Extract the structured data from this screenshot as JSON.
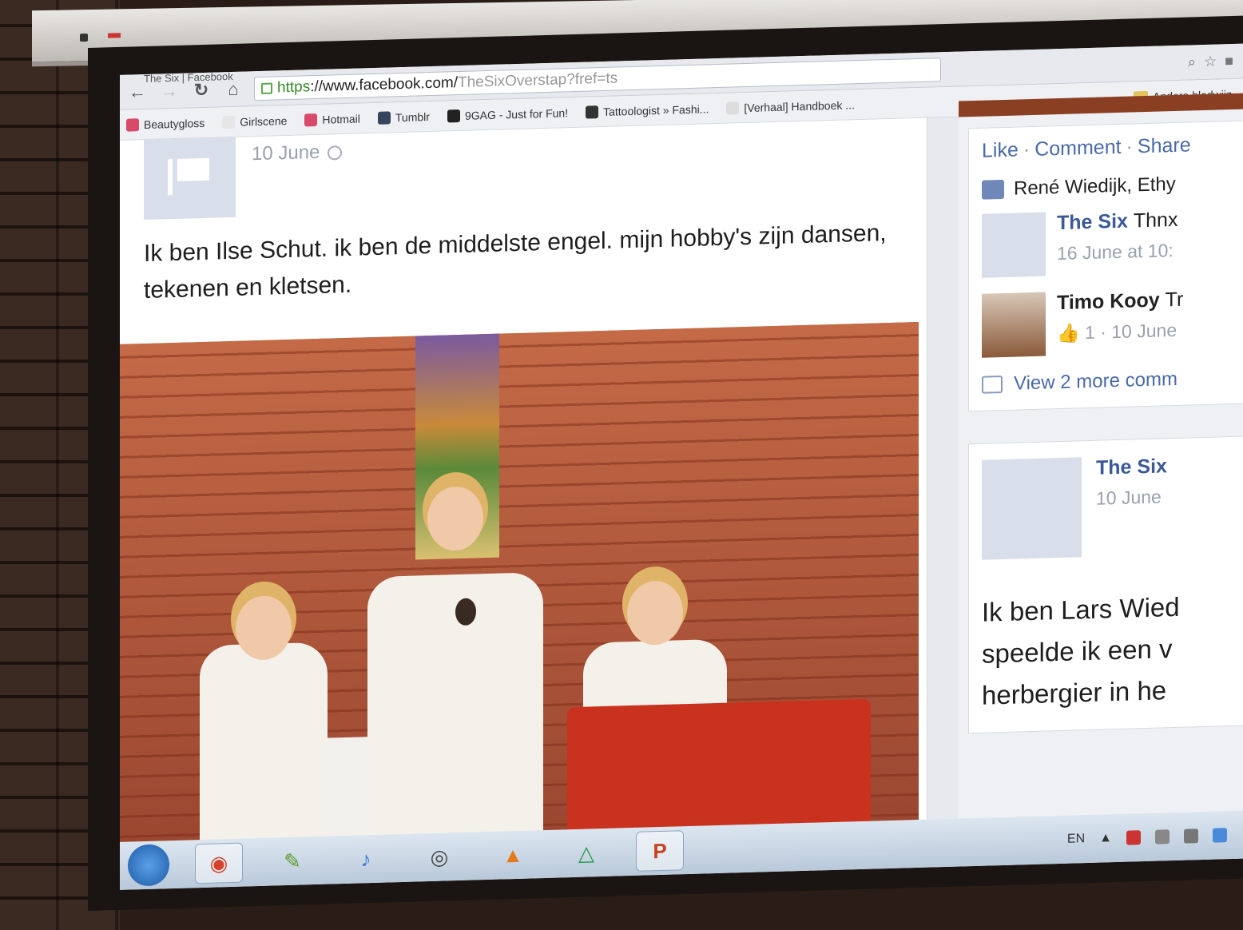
{
  "browser": {
    "tab_title": "The Six | Facebook",
    "url_https": "https",
    "url_host": "://www.facebook.com/",
    "url_path": "TheSixOverstap?fref=ts",
    "bookmarks_top": [
      {
        "label": "Tumblr",
        "color": "#35465c"
      },
      {
        "label": "9GAG - Just for Fun!",
        "color": "#222222"
      },
      {
        "label": "Tattoologist » Fashi...",
        "color": "#333333"
      },
      {
        "label": "[Verhaal] Handboek ...",
        "color": "#dddddd"
      }
    ],
    "bookmarks_left": [
      {
        "label": "Beautygloss",
        "color": "#d94a6a"
      },
      {
        "label": "Girlscene",
        "color": "#e6e6e6"
      },
      {
        "label": "Hotmail",
        "color": "#d94a6a"
      }
    ],
    "other_bookmarks": "Andere bladwijz"
  },
  "post": {
    "date": "10 June",
    "text": "Ik ben Ilse Schut. ik ben de middelste engel. mijn hobby's zijn dansen, tekenen en kletsen."
  },
  "side": {
    "actions": {
      "like": "Like",
      "comment": "Comment",
      "share": "Share"
    },
    "likes_text": "René Wiedijk, Ethy",
    "comments": [
      {
        "name": "The Six",
        "text": "Thnx",
        "meta": "16 June at 10:"
      },
      {
        "name": "Timo Kooy",
        "text": "Tr",
        "meta": "1 · 10 June"
      }
    ],
    "view_more": "View 2 more comm",
    "post2": {
      "name": "The Six",
      "date": "10 June",
      "text_lines": [
        "Ik ben Lars Wied",
        "speelde ik een v",
        "herbergier in he"
      ]
    }
  },
  "taskbar": {
    "apps": [
      {
        "name": "chrome-icon",
        "glyph": "◉",
        "color": "#d9402a"
      },
      {
        "name": "evernote-icon",
        "glyph": "✎",
        "color": "#5a9a2a"
      },
      {
        "name": "itunes-icon",
        "glyph": "♪",
        "color": "#3a7ad9"
      },
      {
        "name": "webcam-icon",
        "glyph": "◎",
        "color": "#444444"
      },
      {
        "name": "fire-icon",
        "glyph": "▲",
        "color": "#e67a1a"
      },
      {
        "name": "drive-icon",
        "glyph": "△",
        "color": "#2a9a4a"
      },
      {
        "name": "powerpoint-icon",
        "glyph": "P",
        "color": "#c8421e"
      }
    ],
    "lang": "EN"
  }
}
